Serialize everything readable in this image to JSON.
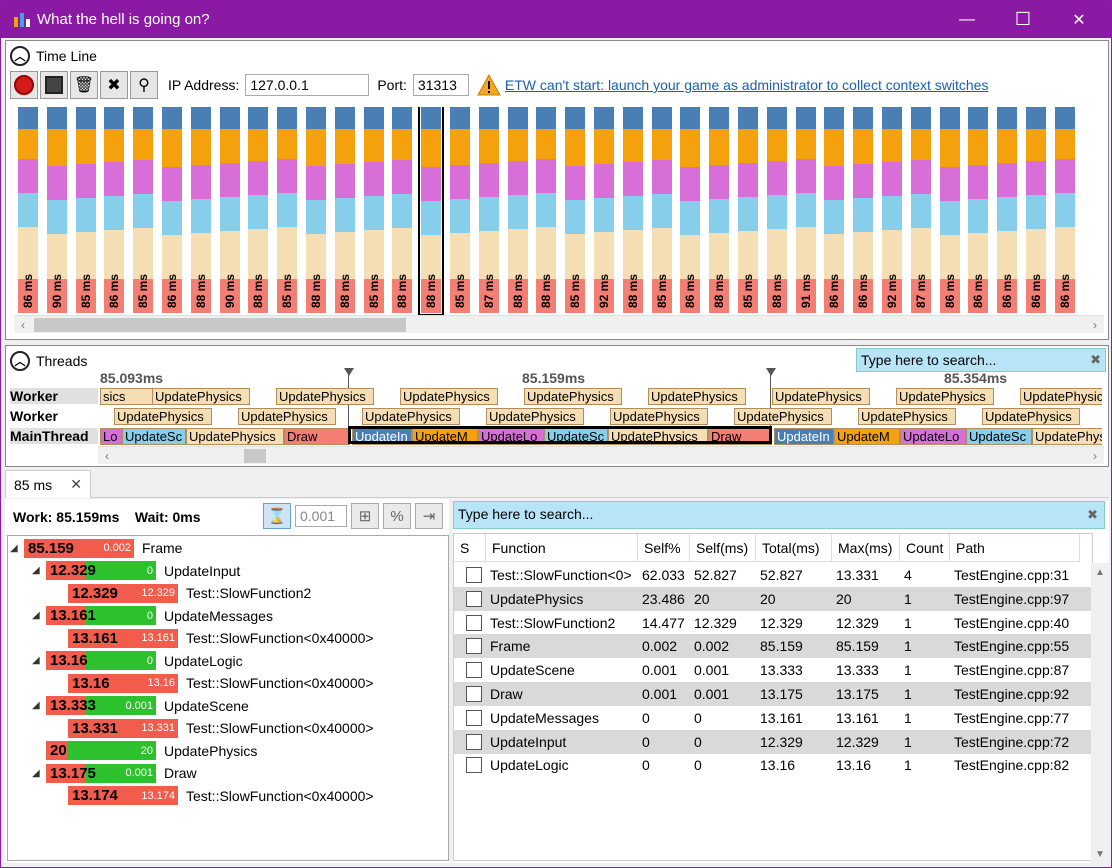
{
  "window": {
    "title": "What the hell is going on?",
    "minimize": "—",
    "maximize": "☐",
    "close": "✕"
  },
  "timeline": {
    "header": "Time Line",
    "ip_label": "IP Address:",
    "ip_value": "127.0.0.1",
    "port_label": "Port:",
    "port_value": "31313",
    "warning_text": "ETW can't start: launch your game as administrator to collect context switches",
    "frames": [
      "86 ms",
      "90 ms",
      "85 ms",
      "86 ms",
      "85 ms",
      "86 ms",
      "88 ms",
      "90 ms",
      "88 ms",
      "85 ms",
      "88 ms",
      "88 ms",
      "85 ms",
      "88 ms",
      "88 ms",
      "85 ms",
      "87 ms",
      "88 ms",
      "88 ms",
      "85 ms",
      "92 ms",
      "88 ms",
      "85 ms",
      "86 ms",
      "88 ms",
      "85 ms",
      "88 ms",
      "91 ms",
      "86 ms",
      "86 ms",
      "92 ms",
      "87 ms",
      "86 ms",
      "86 ms",
      "86 ms",
      "86 ms",
      "86 ms"
    ],
    "selected_index": 14,
    "colors": {
      "blue": "#4a7fb5",
      "orange": "#f5a10d",
      "violet": "#d86fd8",
      "sky": "#87ceeb",
      "wheat": "#f5deb3",
      "salmon": "#f27e74"
    }
  },
  "threads": {
    "header": "Threads",
    "search_placeholder": "Type here to search...",
    "ticks": [
      "85.093ms",
      "85.159ms",
      "85.354ms"
    ],
    "rows": [
      {
        "name": "Worker",
        "blocks": [
          {
            "label": "sics",
            "color": "#f5deb3"
          },
          {
            "label": "UpdatePhysics",
            "color": "#f5deb3"
          },
          {
            "label": "UpdatePhysics",
            "color": "#f5deb3"
          },
          {
            "label": "UpdatePhysics",
            "color": "#f5deb3"
          },
          {
            "label": "UpdatePhysics",
            "color": "#f5deb3"
          },
          {
            "label": "UpdatePhysics",
            "color": "#f5deb3"
          },
          {
            "label": "UpdatePhysics",
            "color": "#f5deb3"
          },
          {
            "label": "UpdatePhysics",
            "color": "#f5deb3"
          },
          {
            "label": "UpdatePhysics",
            "color": "#f5deb3"
          }
        ]
      },
      {
        "name": "Worker",
        "blocks": [
          {
            "label": "UpdatePhysics",
            "color": "#f5deb3"
          },
          {
            "label": "UpdatePhysics",
            "color": "#f5deb3"
          },
          {
            "label": "UpdatePhysics",
            "color": "#f5deb3"
          },
          {
            "label": "UpdatePhysics",
            "color": "#f5deb3"
          },
          {
            "label": "UpdatePhysics",
            "color": "#f5deb3"
          },
          {
            "label": "UpdatePhysics",
            "color": "#f5deb3"
          },
          {
            "label": "UpdatePhysics",
            "color": "#f5deb3"
          },
          {
            "label": "UpdatePhysics",
            "color": "#f5deb3"
          }
        ]
      },
      {
        "name": "MainThread",
        "blocks": [
          {
            "label": "Lo",
            "color": "#d86fd8"
          },
          {
            "label": "UpdateSc",
            "color": "#87ceeb"
          },
          {
            "label": "UpdatePhysics",
            "color": "#f5deb3"
          },
          {
            "label": "Draw",
            "color": "#f27e74"
          },
          {
            "label": "UpdateIn",
            "color": "#4a7fb5"
          },
          {
            "label": "UpdateM",
            "color": "#f5a10d"
          },
          {
            "label": "UpdateLo",
            "color": "#d86fd8"
          },
          {
            "label": "UpdateSc",
            "color": "#87ceeb"
          },
          {
            "label": "UpdatePhysics",
            "color": "#f5deb3"
          },
          {
            "label": "Draw",
            "color": "#f27e74"
          },
          {
            "label": "UpdateIn",
            "color": "#4a7fb5"
          },
          {
            "label": "UpdateM",
            "color": "#f5a10d"
          },
          {
            "label": "UpdateLo",
            "color": "#d86fd8"
          },
          {
            "label": "UpdateSc",
            "color": "#87ceeb"
          },
          {
            "label": "UpdatePhysi",
            "color": "#f5deb3"
          }
        ]
      }
    ]
  },
  "tab": {
    "label": "85 ms",
    "close": "✕"
  },
  "summary": {
    "work": "Work: 85.159ms",
    "wait": "Wait: 0ms",
    "filter_value": "0.001"
  },
  "tree": [
    {
      "total": "85.159",
      "self": "0.002",
      "name": "Frame",
      "expanded": true,
      "level": 0,
      "ratio": 1.0
    },
    {
      "total": "12.329",
      "self": "0",
      "name": "UpdateInput",
      "expanded": true,
      "level": 1,
      "ratio": 0.0
    },
    {
      "total": "12.329",
      "self": "12.329",
      "name": "Test::SlowFunction2",
      "expanded": false,
      "level": 2,
      "ratio": 1.0
    },
    {
      "total": "13.161",
      "self": "0",
      "name": "UpdateMessages",
      "expanded": true,
      "level": 1,
      "ratio": 0.0
    },
    {
      "total": "13.161",
      "self": "13.161",
      "name": "Test::SlowFunction<0x40000>",
      "expanded": false,
      "level": 2,
      "ratio": 1.0
    },
    {
      "total": "13.16",
      "self": "0",
      "name": "UpdateLogic",
      "expanded": true,
      "level": 1,
      "ratio": 0.0
    },
    {
      "total": "13.16",
      "self": "13.16",
      "name": "Test::SlowFunction<0x40000>",
      "expanded": false,
      "level": 2,
      "ratio": 1.0
    },
    {
      "total": "13.333",
      "self": "0.001",
      "name": "UpdateScene",
      "expanded": true,
      "level": 1,
      "ratio": 0.0
    },
    {
      "total": "13.331",
      "self": "13.331",
      "name": "Test::SlowFunction<0x40000>",
      "expanded": false,
      "level": 2,
      "ratio": 1.0
    },
    {
      "total": "20",
      "self": "20",
      "name": "UpdatePhysics",
      "expanded": false,
      "level": 1,
      "ratio": 0.0
    },
    {
      "total": "13.175",
      "self": "0.001",
      "name": "Draw",
      "expanded": true,
      "level": 1,
      "ratio": 0.0
    },
    {
      "total": "13.174",
      "self": "13.174",
      "name": "Test::SlowFunction<0x40000>",
      "expanded": false,
      "level": 2,
      "ratio": 1.0
    }
  ],
  "functions": {
    "search_placeholder": "Type here to search...",
    "columns": [
      "S",
      "Function",
      "Self%",
      "Self(ms)",
      "Total(ms)",
      "Max(ms)",
      "Count",
      "Path"
    ],
    "rows": [
      [
        "Test::SlowFunction<0>",
        "62.033",
        "52.827",
        "52.827",
        "13.331",
        "4",
        "TestEngine.cpp:31"
      ],
      [
        "UpdatePhysics",
        "23.486",
        "20",
        "20",
        "20",
        "1",
        "TestEngine.cpp:97"
      ],
      [
        "Test::SlowFunction2",
        "14.477",
        "12.329",
        "12.329",
        "12.329",
        "1",
        "TestEngine.cpp:40"
      ],
      [
        "Frame",
        "0.002",
        "0.002",
        "85.159",
        "85.159",
        "1",
        "TestEngine.cpp:55"
      ],
      [
        "UpdateScene",
        "0.001",
        "0.001",
        "13.333",
        "13.333",
        "1",
        "TestEngine.cpp:87"
      ],
      [
        "Draw",
        "0.001",
        "0.001",
        "13.175",
        "13.175",
        "1",
        "TestEngine.cpp:92"
      ],
      [
        "UpdateMessages",
        "0",
        "0",
        "13.161",
        "13.161",
        "1",
        "TestEngine.cpp:77"
      ],
      [
        "UpdateInput",
        "0",
        "0",
        "12.329",
        "12.329",
        "1",
        "TestEngine.cpp:72"
      ],
      [
        "UpdateLogic",
        "0",
        "0",
        "13.16",
        "13.16",
        "1",
        "TestEngine.cpp:82"
      ]
    ]
  }
}
